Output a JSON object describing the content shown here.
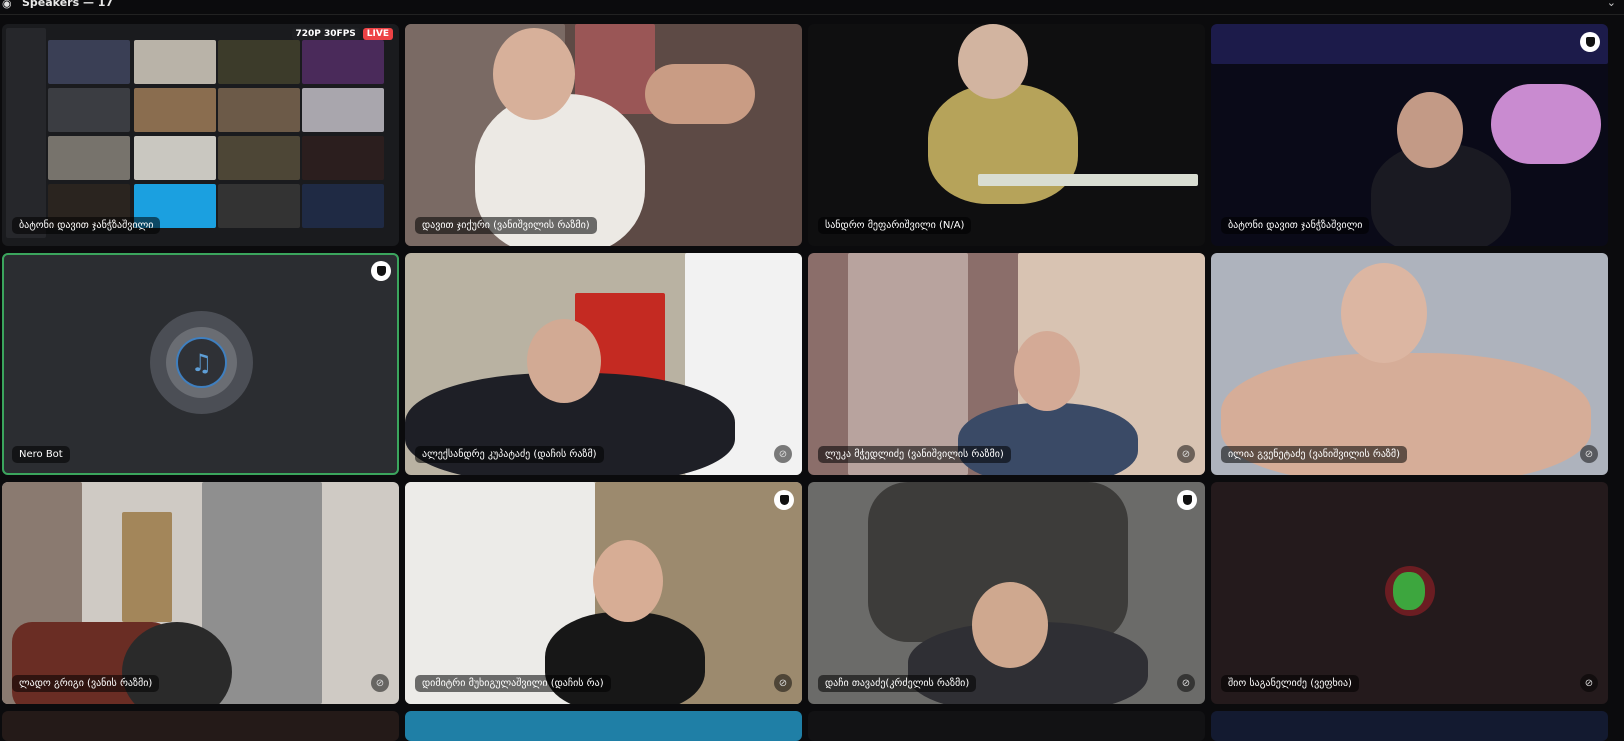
{
  "header": {
    "title": "Speakers — 17",
    "icon": "speaker-icon",
    "chevron": "chevron-down-icon"
  },
  "stream": {
    "resolution_badge": "720P 30FPS",
    "live_badge": "LIVE"
  },
  "tiles": [
    {
      "name": "ბატონი დავით ჯანჭზაშვილი",
      "type": "screen-share"
    },
    {
      "name": "დავით ჯიქური (ვანიშვილის რაზმი)",
      "type": "camera"
    },
    {
      "name": "სანდრო მეფარიშვილი (N/A)",
      "type": "camera"
    },
    {
      "name": "ბატონი დავით ჯანჭზაშვილი",
      "type": "camera"
    },
    {
      "name": "Nero Bot",
      "type": "bot"
    },
    {
      "name": "ალექსანდრე კუპატაძე (დაჩის რაზმ)",
      "type": "camera"
    },
    {
      "name": "ლუკა მჭედლიძე (ვანიშვილის რაზმი)",
      "type": "camera"
    },
    {
      "name": "ილია გვენეტაძე (ვანიშვილის რაზმ)",
      "type": "camera"
    },
    {
      "name": "ლადო გრიგი (ვანის რაზმი)",
      "type": "camera"
    },
    {
      "name": "დიმიტრი მუხიგულაშვილი (დაჩის რა)",
      "type": "camera"
    },
    {
      "name": "დაჩი თავაძე(კრძელის რაზმი)",
      "type": "camera"
    },
    {
      "name": "შიო საგანელიძე (ვეფხია)",
      "type": "avatar"
    }
  ],
  "colors": {
    "speaking_outline": "#3ba55d",
    "live_red": "#ed4245",
    "tile_bg": "#2b2d31"
  }
}
